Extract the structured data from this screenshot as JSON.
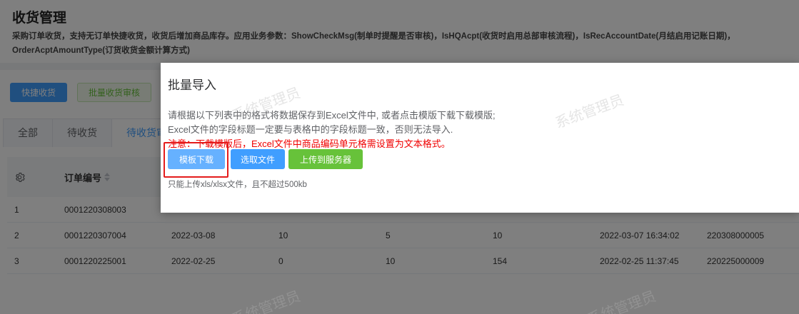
{
  "page": {
    "title": "收货管理",
    "description": "采购订单收货，支持无订单快捷收货，收货后增加商品库存。应用业务参数：ShowCheckMsg(制单时提醒是否审核)，IsHQAcpt(收货时启用总部审核流程)，IsRecAccountDate(月结启用记账日期)，OrderAcptAmountType(订货收货金额计算方式)"
  },
  "toolbar": {
    "quick_receive": "快捷收货",
    "batch_audit": "批量收货审核"
  },
  "tabs": [
    {
      "label": "全部"
    },
    {
      "label": "待收货"
    },
    {
      "label": "待收货审"
    }
  ],
  "table": {
    "header_order_no": "订单编号",
    "rows": [
      {
        "idx": "1",
        "order": "0001220308003",
        "date": "",
        "c3": "",
        "c4": "",
        "c5": "",
        "time": "",
        "code": ""
      },
      {
        "idx": "2",
        "order": "0001220307004",
        "date": "2022-03-08",
        "c3": "10",
        "c4": "5",
        "c5": "10",
        "time": "2022-03-07 16:34:02",
        "code": "220308000005"
      },
      {
        "idx": "3",
        "order": "0001220225001",
        "date": "2022-02-25",
        "c3": "0",
        "c4": "10",
        "c5": "154",
        "time": "2022-02-25 11:37:45",
        "code": "220225000009"
      }
    ]
  },
  "dialog": {
    "title": "批量导入",
    "line1": "请根据以下列表中的格式将数据保存到Excel文件中, 或者点击模版下载下载模版;",
    "line2": "Excel文件的字段标题一定要与表格中的字段标题一致，否则无法导入.",
    "warning": "注意：下载模版后，Excel文件中商品编码单元格需设置为文本格式。",
    "btn_template": "模板下载",
    "btn_choose": "选取文件",
    "btn_upload": "上传到服务器",
    "tip": "只能上传xls/xlsx文件，且不超过500kb"
  },
  "watermark": "系统管理员",
  "colors": {
    "primary": "#409eff",
    "success": "#67c23a",
    "danger": "#f00000",
    "highlight": "#e41c1c"
  }
}
